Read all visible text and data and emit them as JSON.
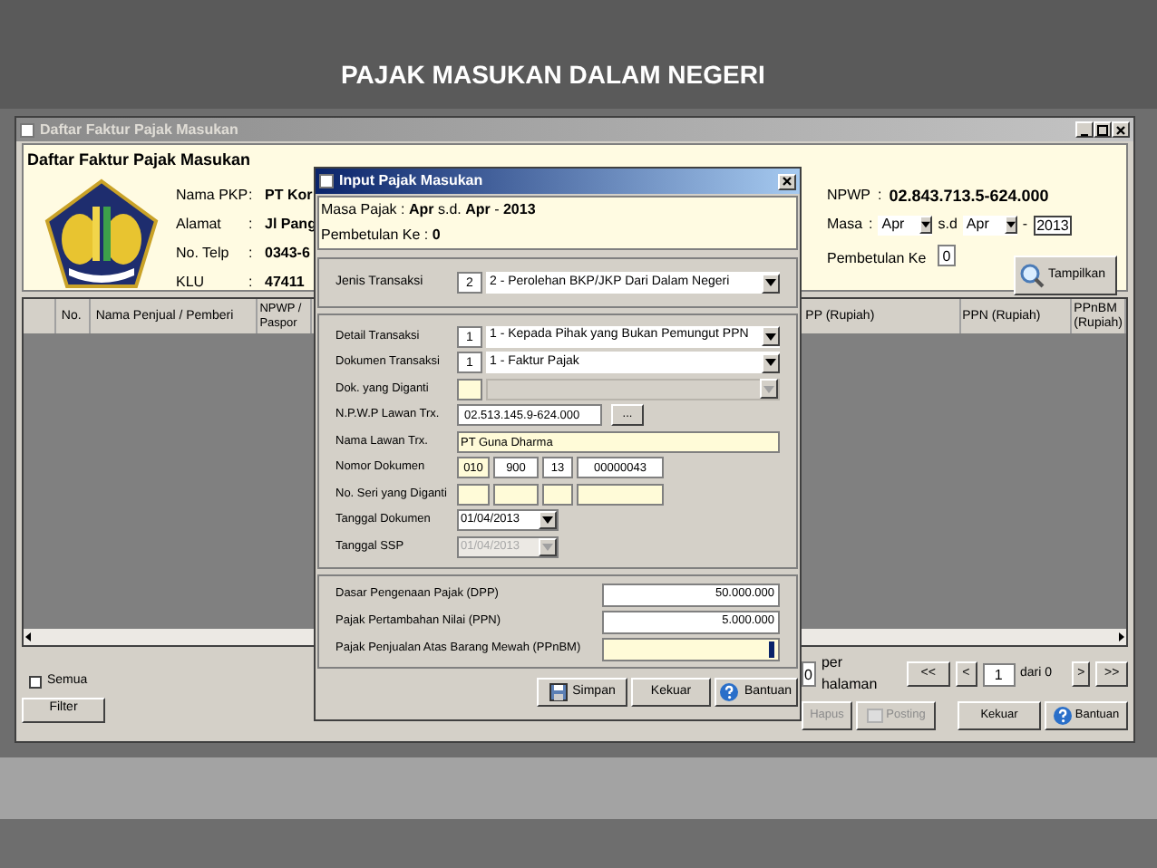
{
  "slide_title": "PAJAK MASUKAN DALAM NEGERI",
  "main_window": {
    "title": "Daftar Faktur Pajak Masukan",
    "heading": "Daftar Faktur Pajak Masukan",
    "info": [
      {
        "label": "Nama PKP",
        "colon": ":",
        "value": "PT Kor"
      },
      {
        "label": "Alamat",
        "colon": ":",
        "value": "Jl Pang"
      },
      {
        "label": "No. Telp",
        "colon": ":",
        "value": "0343-6"
      },
      {
        "label": "KLU",
        "colon": ":",
        "value": "47411"
      }
    ],
    "npwp": {
      "label": "NPWP",
      "colon": ":",
      "value": "02.843.713.5-624.000"
    },
    "masa": {
      "label": "Masa",
      "colon": ":",
      "from": "Apr",
      "to_label": "s.d",
      "to": "Apr",
      "separator": "-",
      "year": "2013"
    },
    "pembetulan": {
      "label": "Pembetulan Ke",
      "value": "0"
    },
    "search_button": "Tampilkan",
    "table": {
      "columns_left": [
        "No.",
        "Nama Penjual / Pemberi",
        "NPWP / Paspor"
      ],
      "columns_right": [
        "PP (Rupiah)",
        "PPN (Rupiah)",
        "PPnBM (Rupiah)"
      ]
    },
    "pagination": {
      "page_size": "0",
      "per_page_label": "per halaman",
      "first": "<<",
      "prev": "<",
      "page": "1",
      "of": "dari 0",
      "next": ">",
      "last": ">>"
    },
    "semua": {
      "label": "Semua",
      "checked": false
    },
    "filter_button": "Filter",
    "buttons": [
      {
        "label": "Hapus",
        "disabled": true
      },
      {
        "label": "Posting",
        "disabled": true
      },
      {
        "label": "Kekuar",
        "disabled": false
      },
      {
        "label": "Bantuan",
        "disabled": false
      }
    ]
  },
  "dialog": {
    "title": "Input Pajak Masukan",
    "masa_pajak": "Masa Pajak : **Apr** s.d. **Apr** - **2013**",
    "pembetulan": "Pembetulan Ke : **0**",
    "jenis": {
      "label": "Jenis Transaksi",
      "code": "2",
      "value": "2 - Perolehan BKP/JKP Dari Dalam Negeri"
    },
    "details": [
      {
        "kind": "select",
        "label": "Detail Transaksi",
        "code": "1",
        "value": "1 - Kepada Pihak yang Bukan Pemungut PPN",
        "highlighted": false,
        "disabled": false
      },
      {
        "kind": "select",
        "label": "Dokumen Transaksi",
        "code": "1",
        "value": "1 - Faktur Pajak",
        "highlighted": false,
        "disabled": false
      },
      {
        "kind": "select",
        "label": "Dok. yang Diganti",
        "highlighted": true,
        "disabled": true
      },
      {
        "kind": "lookup",
        "label": "N.P.W.P Lawan Trx.",
        "value": "02.513.145.9-624.000",
        "button": "..."
      },
      {
        "kind": "text",
        "label": "Nama Lawan Trx.",
        "value": "PT Guna Dharma",
        "highlighted": true
      },
      {
        "kind": "parts",
        "label": "Nomor Dokumen",
        "parts": [
          {
            "value": "010",
            "highlighted": true
          },
          {
            "value": "900",
            "highlighted": false
          },
          {
            "value": "13",
            "highlighted": false
          },
          {
            "value": "00000043",
            "highlighted": false
          }
        ]
      },
      {
        "kind": "parts",
        "label": "No. Seri yang Diganti",
        "parts": [
          {
            "highlighted": true
          },
          {
            "highlighted": true
          },
          {
            "highlighted": true
          },
          {
            "highlighted": true
          }
        ]
      },
      {
        "kind": "date",
        "label": "Tanggal Dokumen",
        "value": "01/04/2013",
        "disabled": false
      },
      {
        "kind": "date",
        "label": "Tanggal SSP",
        "value": "01/04/2013",
        "disabled": true
      }
    ],
    "amounts": [
      {
        "label": "Dasar Pengenaan Pajak (DPP)",
        "value": "50.000.000",
        "highlighted": false,
        "focused": false
      },
      {
        "label": "Pajak Pertambahan Nilai (PPN)",
        "value": "5.000.000",
        "highlighted": false,
        "focused": false
      },
      {
        "label": "Pajak Penjualan Atas Barang Mewah (PPnBM)",
        "highlighted": true,
        "focused": true
      }
    ],
    "buttons": [
      {
        "label": "Simpan"
      },
      {
        "label": "Kekuar"
      },
      {
        "label": "Bantuan"
      }
    ]
  }
}
